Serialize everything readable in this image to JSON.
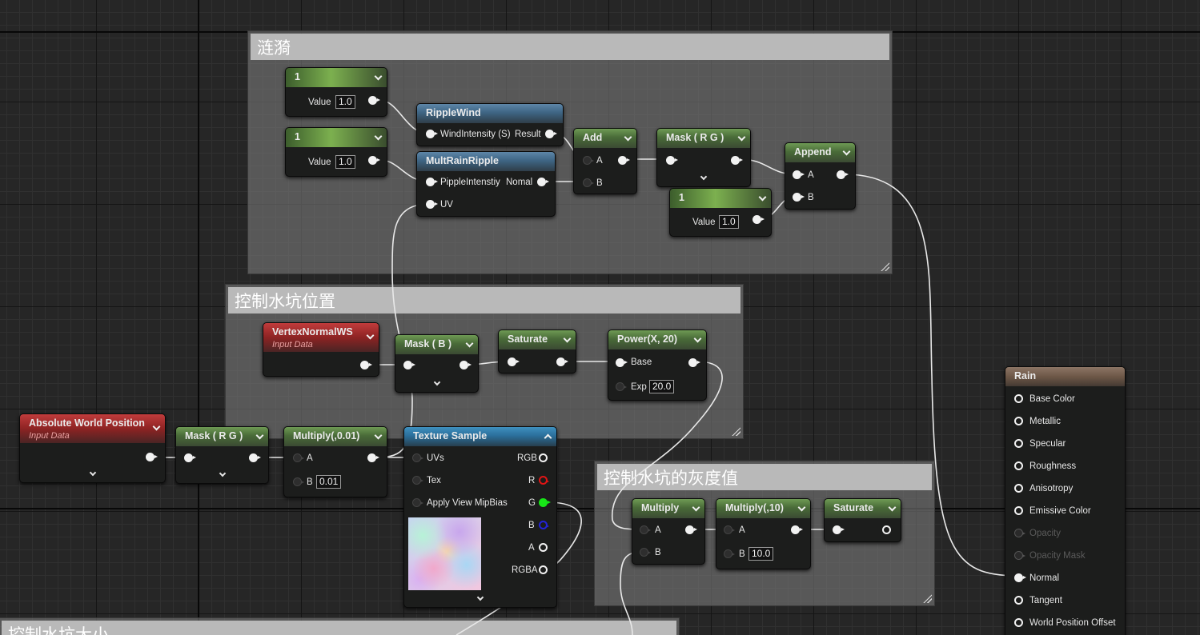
{
  "comments": {
    "ripple": "涟漪",
    "puddle_position": "控制水坑位置",
    "puddle_gray": "控制水坑的灰度值",
    "puddle_size": "控制水坑大小"
  },
  "nodes": {
    "const1": {
      "title": "1",
      "label": "Value",
      "value": "1.0"
    },
    "const2": {
      "title": "1",
      "label": "Value",
      "value": "1.0"
    },
    "const3": {
      "title": "1",
      "label": "Value",
      "value": "1.0"
    },
    "ripple_wind": {
      "title": "RippleWind",
      "input": "WindIntensity (S)",
      "output": "Result"
    },
    "mult_rain_ripple": {
      "title": "MultRainRipple",
      "input1": "PippleIntenstiy",
      "input2": "UV",
      "output": "Nomal"
    },
    "add": {
      "title": "Add",
      "a": "A",
      "b": "B"
    },
    "mask_rg_top": {
      "title": "Mask ( R G )"
    },
    "append": {
      "title": "Append",
      "a": "A",
      "b": "B"
    },
    "vertex_normal": {
      "title": "VertexNormalWS",
      "subtitle": "Input Data"
    },
    "mask_b": {
      "title": "Mask ( B )"
    },
    "saturate1": {
      "title": "Saturate"
    },
    "power": {
      "title": "Power(X, 20)",
      "base": "Base",
      "exp": "Exp",
      "exp_value": "20.0"
    },
    "abs_world_pos": {
      "title": "Absolute World Position",
      "subtitle": "Input Data"
    },
    "mask_rg_bottom": {
      "title": "Mask ( R G )"
    },
    "multiply_001": {
      "title": "Multiply(,0.01)",
      "a": "A",
      "b": "B",
      "b_value": "0.01"
    },
    "texture_sample": {
      "title": "Texture Sample",
      "inputs": [
        "UVs",
        "Tex",
        "Apply View MipBias"
      ],
      "outputs": [
        "RGB",
        "R",
        "G",
        "B",
        "A",
        "RGBA"
      ]
    },
    "multiply": {
      "title": "Multiply",
      "a": "A",
      "b": "B"
    },
    "multiply_10": {
      "title": "Multiply(,10)",
      "a": "A",
      "b": "B",
      "b_value": "10.0"
    },
    "saturate2": {
      "title": "Saturate"
    }
  },
  "material": {
    "title": "Rain",
    "inputs": [
      {
        "label": "Base Color",
        "enabled": true
      },
      {
        "label": "Metallic",
        "enabled": true
      },
      {
        "label": "Specular",
        "enabled": true
      },
      {
        "label": "Roughness",
        "enabled": true
      },
      {
        "label": "Anisotropy",
        "enabled": true
      },
      {
        "label": "Emissive Color",
        "enabled": true
      },
      {
        "label": "Opacity",
        "enabled": false
      },
      {
        "label": "Opacity Mask",
        "enabled": false
      },
      {
        "label": "Normal",
        "enabled": true
      },
      {
        "label": "Tangent",
        "enabled": true
      },
      {
        "label": "World Position Offset",
        "enabled": true
      }
    ]
  },
  "colors": {
    "background": "#262626",
    "wire": "#e8e8e8",
    "pin_g": "#17e617",
    "pin_r": "#e01515",
    "pin_b": "#2323d8"
  }
}
